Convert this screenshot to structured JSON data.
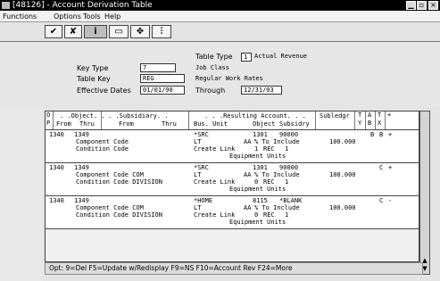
{
  "window": {
    "title": "[48126] - Account Derivation Table"
  },
  "menu": {
    "items": [
      "Functions",
      "Options",
      "Tools",
      "Help"
    ]
  },
  "toolbar": {
    "buttons": [
      "✔",
      "✘",
      "i",
      "▭",
      "✥",
      "⫶"
    ]
  },
  "header": {
    "table_type_label": "Table Type",
    "table_type_value": "1",
    "table_type_desc": "Actual Revenue",
    "key_type_label": "Key Type",
    "key_type_value": "7",
    "key_type_desc": "Job Class",
    "table_key_label": "Table Key",
    "table_key_value": "REG",
    "table_key_desc": "Regular Work Rates",
    "effective_dates_label": "Effective Dates",
    "effective_from": "01/01/90",
    "through_label": "Through",
    "effective_through": "12/31/03"
  },
  "grid": {
    "col_op": "O\nP",
    "col_object": ". .Object. .",
    "col_from": "From",
    "col_thru": "Thru",
    "col_subsidiary": ". .Subsidiary. .",
    "col_sub_from": "From",
    "col_sub_thru": "Thru",
    "col_resulting": ". . .Resulting Account. . .",
    "col_bus_unit": "Bus. Unit",
    "col_obj": "Object",
    "col_subsidry": "Subsidry",
    "col_subledger": "Subledgr",
    "col_t": "T\nY",
    "col_a": "A\nB",
    "col_x": "T\nX",
    "col_plus": "+",
    "rows": [
      {
        "from": "1340",
        "thru": "1349",
        "bus_unit": "*SRC",
        "object": "1301",
        "subsidiary": "90000",
        "line2_left": "Component Code",
        "line2_mid": "LT",
        "line2_aa": "AA",
        "line2_desc": "% To Include",
        "line2_pct": "100.000",
        "line3_left": "Condition Code",
        "line3_mid": "Create Link",
        "line3_num": "1",
        "line3_rec": "REC",
        "line3_val": "1",
        "line4": "Equipment   Units",
        "ab": "B",
        "tx": "B",
        "plus": "+"
      },
      {
        "from": "1340",
        "thru": "1349",
        "bus_unit": "*SRC",
        "object": "1301",
        "subsidiary": "90000",
        "line2_left": "Component Code COM",
        "line2_mid": "LT",
        "line2_aa": "AA",
        "line2_desc": "% To Include",
        "line2_pct": "100.000",
        "line3_left": "Condition Code DIVISION",
        "line3_mid": "Create Link",
        "line3_num": "0",
        "line3_rec": "REC",
        "line3_val": "1",
        "line4": "Equipment   Units",
        "ab": "C",
        "tx": "",
        "plus": "+"
      },
      {
        "from": "1340",
        "thru": "1349",
        "bus_unit": "*HOME",
        "object": "8115",
        "subsidiary": "*BLANK",
        "line2_left": "Component Code COM",
        "line2_mid": "LT",
        "line2_aa": "AA",
        "line2_desc": "% To Include",
        "line2_pct": "100.000",
        "line3_left": "Condition Code DIVISION",
        "line3_mid": "Create Link",
        "line3_num": "0",
        "line3_rec": "REC",
        "line3_val": "1",
        "line4": "Equipment   Units",
        "ab": "C",
        "tx": "",
        "plus": "-"
      }
    ]
  },
  "status": {
    "text": "Opt: 9=Del F5=Update w/Redisplay F9=NS F10=Account Rev F24=More"
  }
}
